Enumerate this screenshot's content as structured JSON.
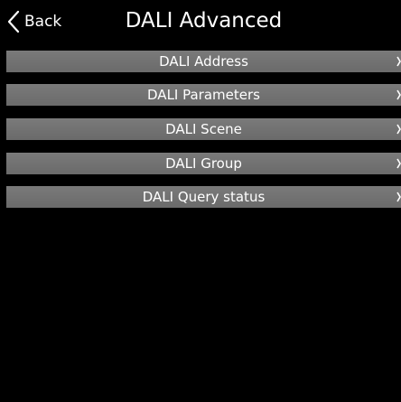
{
  "header": {
    "back_label": "Back",
    "back_icon": "chevron-left-icon",
    "title": "DALI Advanced"
  },
  "menu": {
    "items": [
      {
        "label": "DALI Address",
        "icon": "chevron-right-icon"
      },
      {
        "label": "DALI Parameters",
        "icon": "chevron-right-icon"
      },
      {
        "label": "DALI Scene",
        "icon": "chevron-right-icon"
      },
      {
        "label": "DALI Group",
        "icon": "chevron-right-icon"
      },
      {
        "label": "DALI Query status",
        "icon": "chevron-right-icon"
      }
    ]
  },
  "colors": {
    "background": "#000000",
    "menu_item": "#707070",
    "text": "#ffffff"
  }
}
